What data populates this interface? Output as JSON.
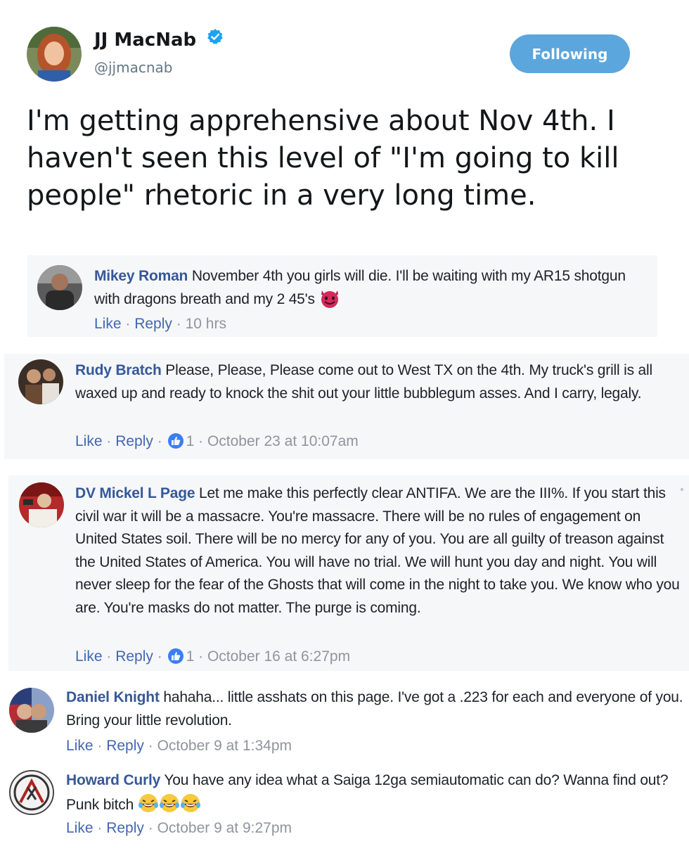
{
  "tweet": {
    "author_name": "JJ MacNab",
    "handle": "@jjmacnab",
    "follow_label": "Following",
    "text": "I'm getting apprehensive about Nov 4th.  I haven't seen this level of \"I'm going to kill people\" rhetoric in a very long time."
  },
  "colors": {
    "accent": "#5ba6dd",
    "fb_name": "#365899",
    "fb_link": "#4267b2",
    "fb_meta": "#90949c",
    "fb_bg": "#f6f7f9"
  },
  "comments": [
    {
      "name": "Mikey Roman",
      "text": " November 4th you girls will die. I'll be waiting with my AR15 shotgun with dragons breath and my 2 45's",
      "emoji": "smiling-devil-emoji",
      "like": "Like",
      "reply": "Reply",
      "reactions": "",
      "time": "10 hrs"
    },
    {
      "name": "Rudy Bratch",
      "text": " Please, Please, Please come out to West TX on the 4th. My truck's grill is all waxed up and ready to knock the shit out your little bubblegum asses. And I carry, legaly.",
      "like": "Like",
      "reply": "Reply",
      "reactions": "1",
      "time": "October 23 at 10:07am"
    },
    {
      "name": "DV Mickel L Page",
      "text": " Let me make this perfectly clear ANTIFA. We are the III%. If you start this civil war it will be a massacre. You're massacre. There will be no rules of engagement on United States soil. There will be no mercy for any of you. You are all guilty of treason against the United States of America. You will have no trial. We will hunt you day and night. You will never sleep for the fear of the Ghosts that will come in the night to take you. We know who you are. You're masks do not matter. The purge is coming.",
      "like": "Like",
      "reply": "Reply",
      "reactions": "1",
      "time": "October 16 at 6:27pm"
    },
    {
      "name": "Daniel Knight",
      "text": " hahaha... little asshats on this page. I've got a .223 for each and everyone of you. Bring your little revolution.",
      "like": "Like",
      "reply": "Reply",
      "reactions": "",
      "time": "October 9 at 1:34pm"
    },
    {
      "name": "Howard Curly",
      "text": " You have any idea what a Saiga 12ga semiautomatic can do? Wanna find out? Punk bitch",
      "emoji": "laughing-tears-emoji",
      "like": "Like",
      "reply": "Reply",
      "reactions": "",
      "time": "October 9 at 9:27pm"
    }
  ]
}
